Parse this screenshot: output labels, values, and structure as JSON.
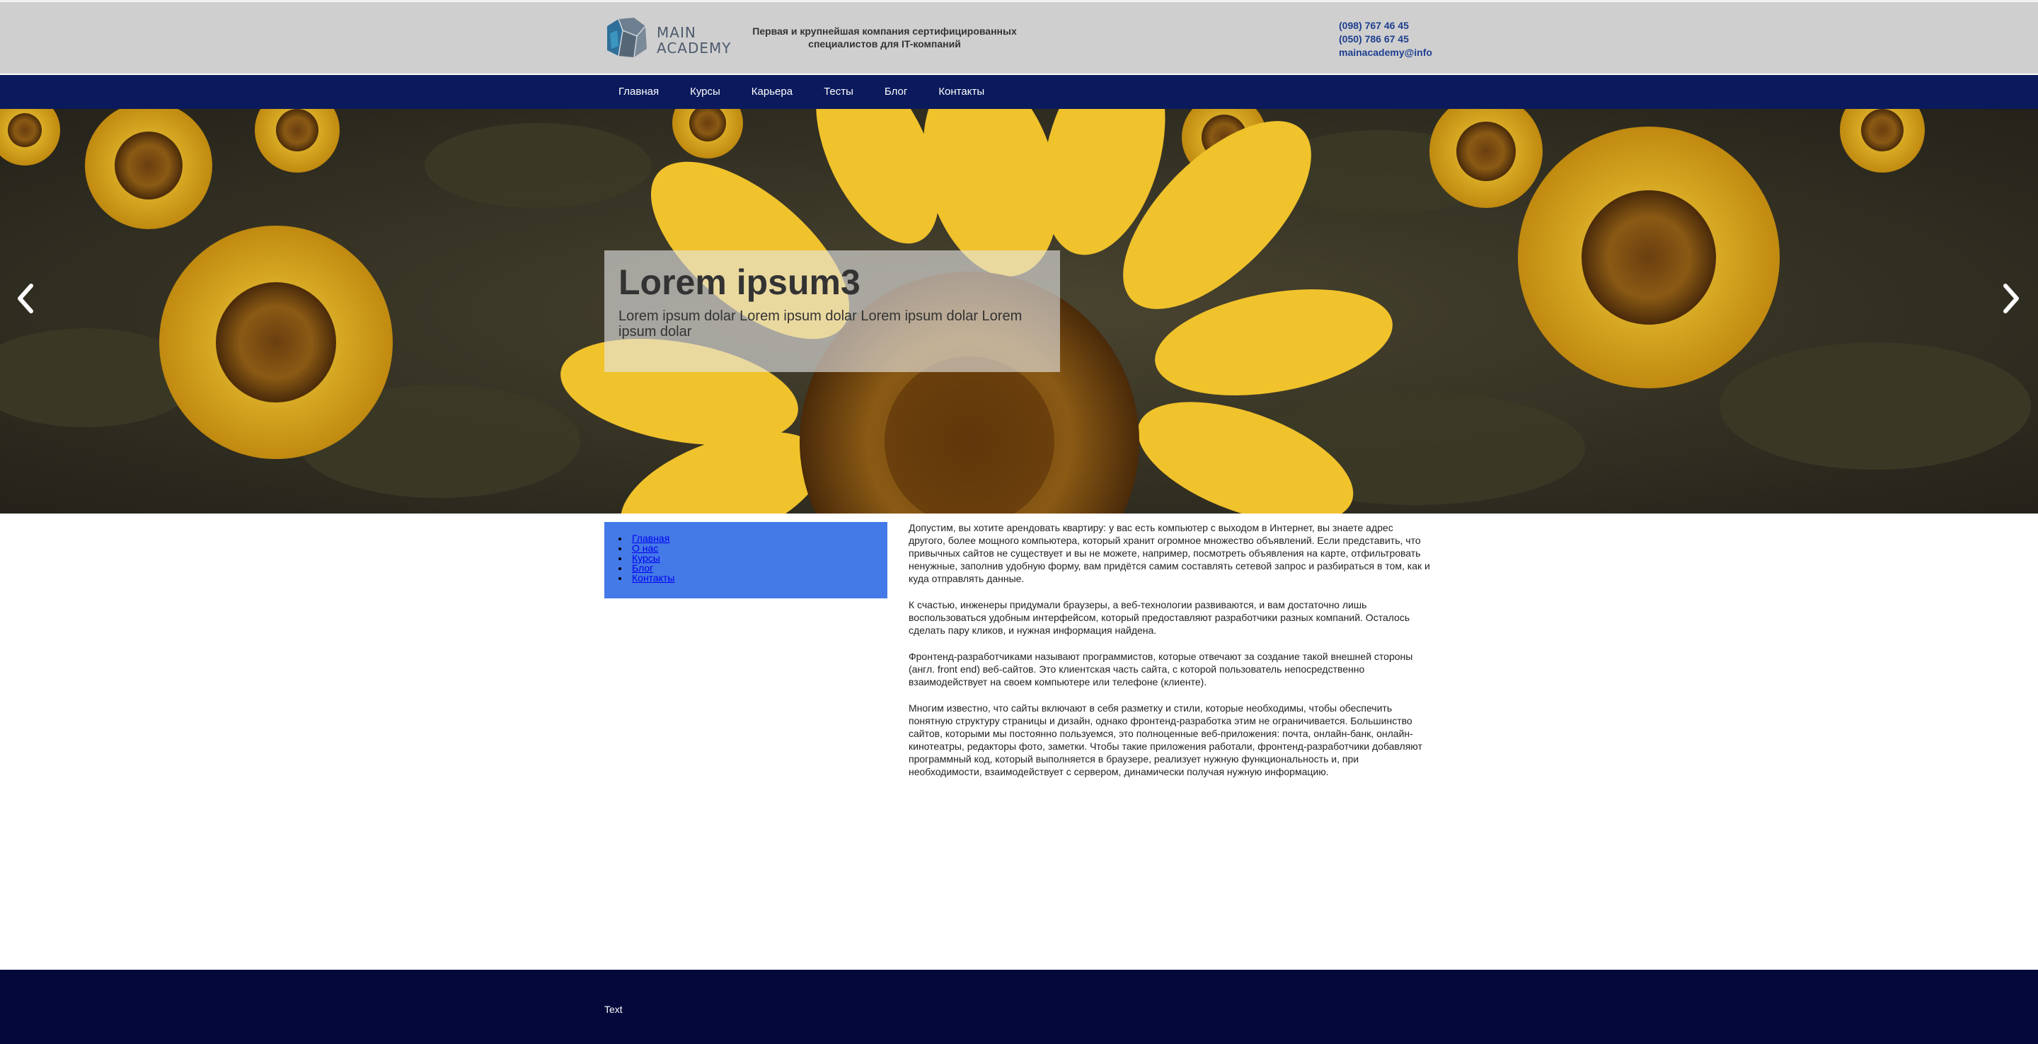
{
  "header": {
    "logo_text_line1": "MAIN",
    "logo_text_line2": "ACADEMY",
    "tagline_line1": "Первая и крупнейшая компания сертифицированных",
    "tagline_line2": "специалистов для IT-компаний",
    "phone1": "(098) 767 46 45",
    "phone2": "(050) 786 67 45",
    "email": "mainacademy@info"
  },
  "nav": {
    "items": [
      {
        "label": "Главная"
      },
      {
        "label": "Курсы"
      },
      {
        "label": "Карьера"
      },
      {
        "label": "Тесты"
      },
      {
        "label": "Блог"
      },
      {
        "label": "Контакты"
      }
    ]
  },
  "hero": {
    "title": "Lorem ipsum3",
    "text": "Lorem ipsum dolar Lorem ipsum dolar Lorem ipsum dolar Lorem ipsum dolar",
    "prev_icon": "chevron-left-icon",
    "next_icon": "chevron-right-icon"
  },
  "sidebar": {
    "links": [
      {
        "label": "Главная"
      },
      {
        "label": "О нас"
      },
      {
        "label": "Курсы"
      },
      {
        "label": "Блог"
      },
      {
        "label": "Контакты"
      }
    ]
  },
  "article": {
    "paragraphs": [
      "Допустим, вы хотите арендовать квартиру: у вас есть компьютер с выходом в Интернет, вы знаете адрес другого, более мощного компьютера, который хранит огромное множество объявлений. Если представить, что привычных сайтов не существует и вы не можете, например, посмотреть объявления на карте, отфильтровать ненужные, заполнив удобную форму, вам придётся самим составлять сетевой запрос и разбираться в том, как и куда отправлять данные.",
      "К счастью, инженеры придумали браузеры, а веб-технологии развиваются, и вам достаточно лишь воспользоваться удобным интерфейсом, который предоставляют разработчики разных компаний. Осталось сделать пару кликов, и нужная информация найдена.",
      "Фронтенд-разработчиками называют программистов, которые отвечают за создание такой внешней стороны (англ. front end) веб-сайтов. Это клиентская часть сайта, с которой пользователь непосредственно взаимодействует на своем компьютере или телефоне (клиенте).",
      "Многим известно, что сайты включают в себя разметку и стили, которые необходимы, чтобы обеспечить понятную структуру страницы и дизайн, однако фронтенд-разработка этим не ограничивается. Большинство сайтов, которыми мы постоянно пользуемся, это полноценные веб-приложения: почта, онлайн-банк, онлайн-кинотеатры, редакторы фото, заметки. Чтобы такие приложения работали, фронтенд-разработчики добавляют программный код, который выполняется в браузере, реализует нужную функциональность и, при необходимости, взаимодействует с сервером, динамически получая нужную информацию."
    ]
  },
  "footer": {
    "text": "Text"
  },
  "colors": {
    "header_bg": "#cfcfcf",
    "nav_bg": "#0a1a5c",
    "sidebar_bg": "#4479e8",
    "footer_bg": "#04083a",
    "contact_text": "#1e3f8f"
  }
}
